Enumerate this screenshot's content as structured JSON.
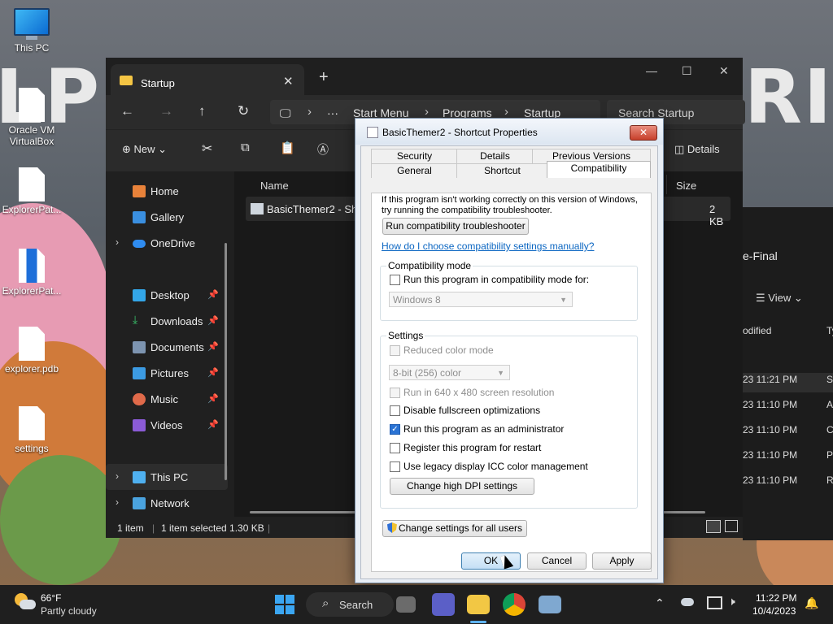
{
  "desktop": {
    "icons": [
      {
        "label": "This PC",
        "icon": "monitor-icon"
      },
      {
        "label": "Oracle VM VirtualBox",
        "icon": "shortcut-file-icon"
      },
      {
        "label": "ExplorerPat...",
        "icon": "file-icon"
      },
      {
        "label": "ExplorerPat...",
        "icon": "word-document-icon"
      },
      {
        "label": "explorer.pdb",
        "icon": "file-icon"
      },
      {
        "label": "settings",
        "icon": "file-icon"
      }
    ]
  },
  "explorer": {
    "tab_title": "Startup",
    "new_tab": "+",
    "breadcrumb": [
      "Start Menu",
      "Programs",
      "Startup"
    ],
    "search_placeholder": "Search Startup",
    "toolbar": {
      "new_label": "New",
      "details_label": "Details"
    },
    "sidebar": {
      "home": "Home",
      "gallery": "Gallery",
      "onedrive": "OneDrive",
      "desktop": "Desktop",
      "downloads": "Downloads",
      "documents": "Documents",
      "pictures": "Pictures",
      "music": "Music",
      "videos": "Videos",
      "thispc": "This PC",
      "network": "Network"
    },
    "columns": {
      "name": "Name",
      "size": "Size"
    },
    "file": {
      "name": "BasicThemer2 - Short",
      "size": "2 KB"
    },
    "status": {
      "count": "1 item",
      "selected": "1 item selected  1.30 KB"
    }
  },
  "explorer2": {
    "title": "e-Final",
    "view": "View",
    "col_modified": "odified",
    "col_type": "Ty",
    "rows": [
      {
        "date": "23 11:21 PM",
        "type": "Sl"
      },
      {
        "date": "23 11:10 PM",
        "type": "A"
      },
      {
        "date": "23 11:10 PM",
        "type": "C"
      },
      {
        "date": "23 11:10 PM",
        "type": "P"
      },
      {
        "date": "23 11:10 PM",
        "type": "R"
      }
    ]
  },
  "dialog": {
    "title": "BasicThemer2 - Shortcut Properties",
    "tabs_row1": [
      "Security",
      "Details",
      "Previous Versions"
    ],
    "tabs_row2": [
      "General",
      "Shortcut",
      "Compatibility"
    ],
    "intro_line1": "If this program isn't working correctly on this version of Windows,",
    "intro_line2": "try running the compatibility troubleshooter.",
    "troubleshooter_btn": "Run compatibility troubleshooter",
    "help_link": "How do I choose compatibility settings manually?",
    "compat_group": "Compatibility mode",
    "compat_check": "Run this program in compatibility mode for:",
    "compat_os": "Windows 8",
    "settings_group": "Settings",
    "reduced_color": "Reduced color mode",
    "color_option": "8-bit (256) color",
    "run_640": "Run in 640 x 480 screen resolution",
    "disable_fullscreen": "Disable fullscreen optimizations",
    "run_admin": "Run this program as an administrator",
    "register_restart": "Register this program for restart",
    "legacy_icc": "Use legacy display ICC color management",
    "dpi_btn": "Change high DPI settings",
    "all_users_btn": "Change settings for all users",
    "ok": "OK",
    "cancel": "Cancel",
    "apply": "Apply"
  },
  "taskbar": {
    "temp": "66°F",
    "weather": "Partly cloudy",
    "search": "Search",
    "time": "11:22 PM",
    "date": "10/4/2023"
  }
}
